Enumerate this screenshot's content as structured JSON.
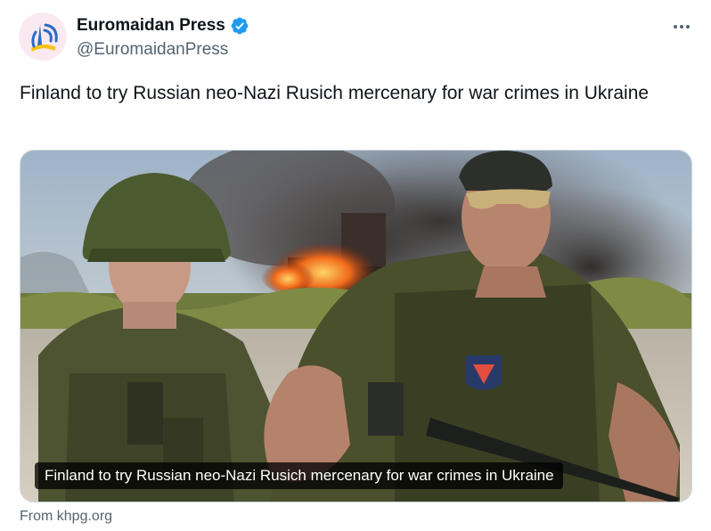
{
  "author": {
    "display_name": "Euromaidan Press",
    "handle": "@EuromaidanPress",
    "verified": true,
    "avatar_icon": "euromaidan-press-logo"
  },
  "tweet": {
    "text": "Finland to try Russian neo-Nazi Rusich mercenary for war crimes in Ukraine"
  },
  "media": {
    "caption": "Finland to try Russian neo-Nazi Rusich mercenary for war crimes in Ukraine"
  },
  "link_card": {
    "source": "From khpg.org"
  },
  "icons": {
    "more": "more-options-icon",
    "verified": "verified-badge-icon"
  },
  "colors": {
    "text_primary": "#0f1419",
    "text_secondary": "#536471",
    "verified_blue": "#1d9bf0",
    "border": "#cfd9de"
  }
}
